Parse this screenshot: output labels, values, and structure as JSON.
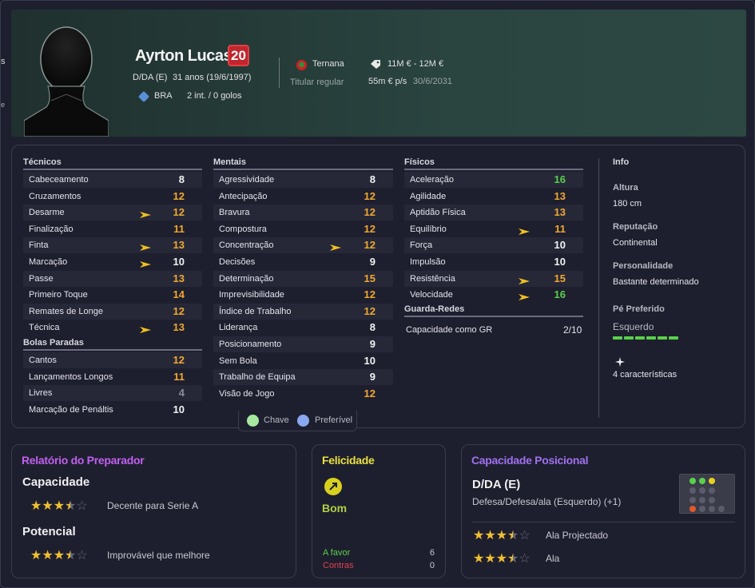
{
  "player": {
    "name": "Ayrton Lucas",
    "number": "20",
    "position": "D/DA (E)",
    "age": "31 anos (19/6/1997)",
    "nation": "BRA",
    "caps": "2 int. / 0 golos",
    "club": "Ternana",
    "role": "Titular regular",
    "value": "11M € - 12M €",
    "wage": "55m € p/s",
    "contract": "30/6/2031"
  },
  "technical": {
    "title": "Técnicos",
    "rows": [
      {
        "label": "Cabeceamento",
        "value": "8"
      },
      {
        "label": "Cruzamentos",
        "value": "12"
      },
      {
        "label": "Desarme",
        "value": "12"
      },
      {
        "label": "Finalização",
        "value": "11"
      },
      {
        "label": "Finta",
        "value": "13"
      },
      {
        "label": "Marcação",
        "value": "10"
      },
      {
        "label": "Passe",
        "value": "13"
      },
      {
        "label": "Primeiro Toque",
        "value": "14"
      },
      {
        "label": "Remates de Longe",
        "value": "12"
      },
      {
        "label": "Técnica",
        "value": "13"
      }
    ]
  },
  "setpieces": {
    "title": "Bolas Paradas",
    "rows": [
      {
        "label": "Cantos",
        "value": "12"
      },
      {
        "label": "Lançamentos Longos",
        "value": "11"
      },
      {
        "label": "Livres",
        "value": "4"
      },
      {
        "label": "Marcação de Penáltis",
        "value": "10"
      }
    ]
  },
  "mental": {
    "title": "Mentais",
    "rows": [
      {
        "label": "Agressividade",
        "value": "8"
      },
      {
        "label": "Antecipação",
        "value": "12"
      },
      {
        "label": "Bravura",
        "value": "12"
      },
      {
        "label": "Compostura",
        "value": "12"
      },
      {
        "label": "Concentração",
        "value": "12"
      },
      {
        "label": "Decisões",
        "value": "9"
      },
      {
        "label": "Determinação",
        "value": "15"
      },
      {
        "label": "Imprevisibilidade",
        "value": "12"
      },
      {
        "label": "Índice de Trabalho",
        "value": "12"
      },
      {
        "label": "Liderança",
        "value": "8"
      },
      {
        "label": "Posicionamento",
        "value": "9"
      },
      {
        "label": "Sem Bola",
        "value": "10"
      },
      {
        "label": "Trabalho de Equipa",
        "value": "9"
      },
      {
        "label": "Visão de Jogo",
        "value": "12"
      }
    ]
  },
  "physical": {
    "title": "Físicos",
    "rows": [
      {
        "label": "Aceleração",
        "value": "16"
      },
      {
        "label": "Agilidade",
        "value": "13"
      },
      {
        "label": "Aptidão Física",
        "value": "13"
      },
      {
        "label": "Equilíbrio",
        "value": "11"
      },
      {
        "label": "Força",
        "value": "10"
      },
      {
        "label": "Impulsão",
        "value": "10"
      },
      {
        "label": "Resistência",
        "value": "15"
      },
      {
        "label": "Velocidade",
        "value": "16"
      }
    ]
  },
  "goalkeeping": {
    "title": "Guarda-Redes",
    "label": "Capacidade como GR",
    "value": "2/10"
  },
  "info": {
    "title": "Info",
    "height_label": "Altura",
    "height": "180 cm",
    "reputation_label": "Reputação",
    "reputation": "Continental",
    "personality_label": "Personalidade",
    "personality": "Bastante determinado",
    "foot_label": "Pé Preferido",
    "foot": "Esquerdo",
    "traits": "4 características"
  },
  "legend": {
    "key": "Chave",
    "preferable": "Preferível"
  },
  "report": {
    "title": "Relatório do Preparador",
    "ability_label": "Capacidade",
    "ability_stars": 3.5,
    "ability_desc": "Decente para Serie A",
    "potential_label": "Potencial",
    "potential_stars": 3.5,
    "potential_desc": "Improvável que melhore"
  },
  "happiness": {
    "title": "Felicidade",
    "status": "Bom",
    "favor_label": "A favor",
    "favor_count": "6",
    "against_label": "Contras",
    "against_count": "0"
  },
  "positional": {
    "title": "Capacidade Posicional",
    "position": "D/DA (E)",
    "description": "Defesa/Defesa/ala (Esquerdo) (+1)",
    "role1": "Ala Projectado",
    "role1_stars": 3.5,
    "role2": "Ala",
    "role2_stars": 3.5
  },
  "colors": {
    "accent_orange": "#f0a830",
    "accent_green": "#5ad04a",
    "badge_red": "#c0262c"
  }
}
